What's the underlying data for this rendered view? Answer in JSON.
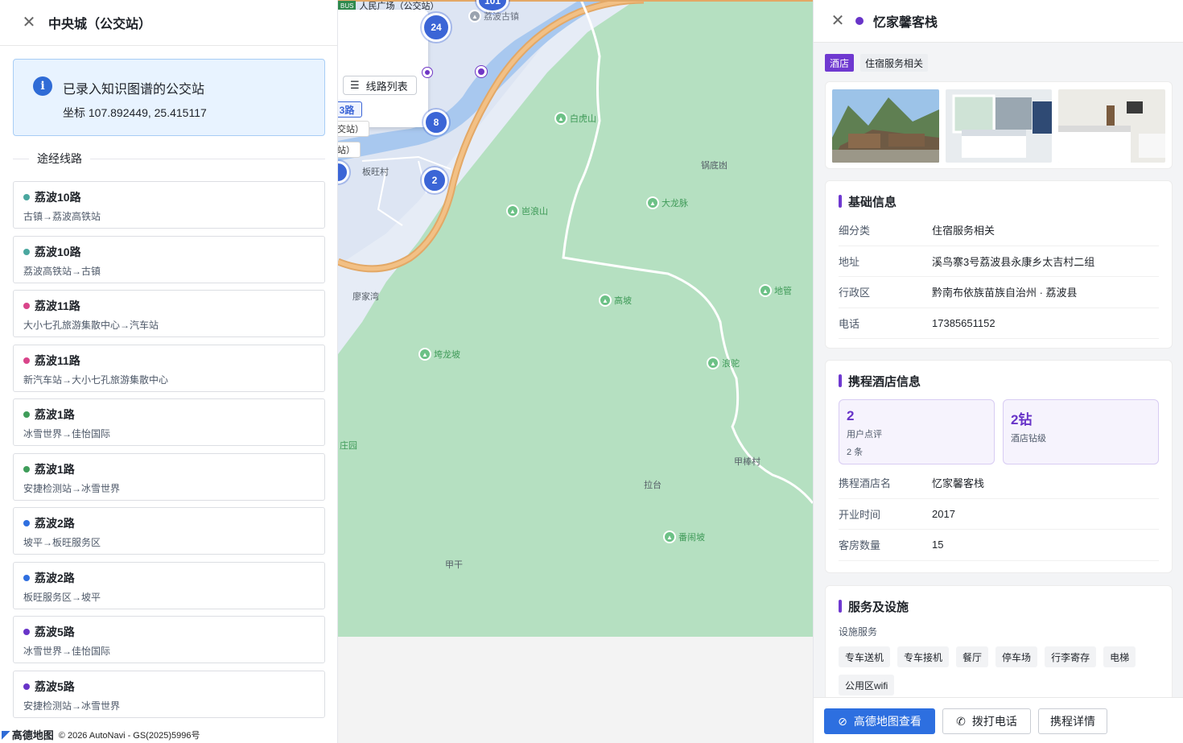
{
  "left_panel": {
    "title": "中央城（公交站）",
    "info_title": "已录入知识图谱的公交站",
    "info_coord": "坐标 107.892449, 25.415117",
    "section_label": "途经线路",
    "routes": [
      {
        "name": "荔波10路",
        "direction": "古镇→荔波高铁站",
        "color": "#4aa79f"
      },
      {
        "name": "荔波10路",
        "direction": "荔波高铁站→古镇",
        "color": "#4aa79f"
      },
      {
        "name": "荔波11路",
        "direction": "大小七孔旅游集散中心→汽车站",
        "color": "#d9458a"
      },
      {
        "name": "荔波11路",
        "direction": "新汽车站→大小七孔旅游集散中心",
        "color": "#d9458a"
      },
      {
        "name": "荔波1路",
        "direction": "冰雪世界→佳怡国际",
        "color": "#3f9d5a"
      },
      {
        "name": "荔波1路",
        "direction": "安捷检测站→冰雪世界",
        "color": "#3f9d5a"
      },
      {
        "name": "荔波2路",
        "direction": "坡平→板旺服务区",
        "color": "#2f6fe0"
      },
      {
        "name": "荔波2路",
        "direction": "板旺服务区→坡平",
        "color": "#2f6fe0"
      },
      {
        "name": "荔波5路",
        "direction": "冰雪世界→佳怡国际",
        "color": "#6834c8"
      },
      {
        "name": "荔波5路",
        "direction": "安捷检测站→冰雪世界",
        "color": "#6834c8"
      }
    ]
  },
  "map": {
    "bus_badge": "BUS",
    "top_label": "人民广场（公交站）",
    "route_list_button": "线路列表",
    "route_chip": "3路",
    "stop_label_1": "交站）",
    "stop_label_2": "站）",
    "clusters": [
      "101",
      "24",
      "8",
      "2"
    ],
    "pois": [
      "白虎山",
      "岜浪山",
      "大龙脉",
      "高坡",
      "地管",
      "垮龙坡",
      "浪驼",
      "番闹坡",
      "荔波古镇"
    ],
    "places": [
      "锅底凼",
      "板旺村",
      "廖家湾",
      "拉台",
      "甲棒村",
      "甲干",
      "庄园"
    ],
    "brand_name": "高德地图",
    "copyright": "© 2026 AutoNavi - GS(2025)5996号"
  },
  "right_panel": {
    "title": "忆家馨客栈",
    "tags": [
      "酒店",
      "住宿服务相关"
    ],
    "basic": {
      "title": "基础信息",
      "rows": [
        {
          "k": "细分类",
          "v": "住宿服务相关"
        },
        {
          "k": "地址",
          "v": "溪鸟寨3号荔波县永康乡太吉村二组"
        },
        {
          "k": "行政区",
          "v": "黔南布依族苗族自治州 · 荔波县"
        },
        {
          "k": "电话",
          "v": "17385651152"
        }
      ]
    },
    "ctrip": {
      "title": "携程酒店信息",
      "review_num": "2",
      "review_label": "用户点评",
      "review_sub": "2 条",
      "star_num": "2钻",
      "star_label": "酒店钻级",
      "rows": [
        {
          "k": "携程酒店名",
          "v": "忆家馨客栈"
        },
        {
          "k": "开业时间",
          "v": "2017"
        },
        {
          "k": "客房数量",
          "v": "15"
        }
      ]
    },
    "services": {
      "title": "服务及设施",
      "sub": "设施服务",
      "items": [
        "专车送机",
        "专车接机",
        "餐厅",
        "停车场",
        "行李寄存",
        "电梯",
        "公用区wifi"
      ]
    },
    "buttons": {
      "amap": "高德地图查看",
      "call": "拨打电话",
      "ctrip": "携程详情"
    }
  }
}
